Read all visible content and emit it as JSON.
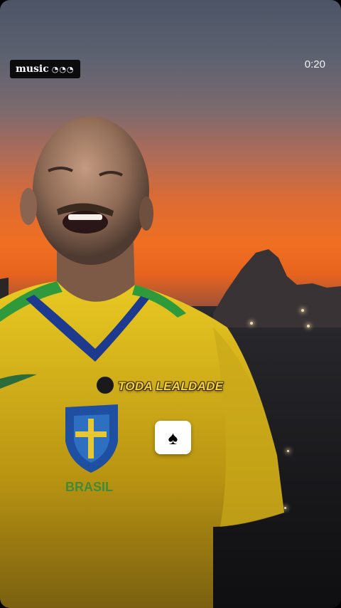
{
  "badge": {
    "label": "music",
    "dots": "◔◔◔"
  },
  "player": {
    "elapsed": "0:20"
  },
  "caption": {
    "text": "TODA LEALDADE"
  },
  "action_button": {
    "icon": "spade-icon",
    "glyph": "♠"
  },
  "shirt_text": "BRASIL",
  "colors": {
    "caption": "#f7d23a",
    "jersey": "#e0c21a",
    "sky_orange": "#ef6f22"
  }
}
